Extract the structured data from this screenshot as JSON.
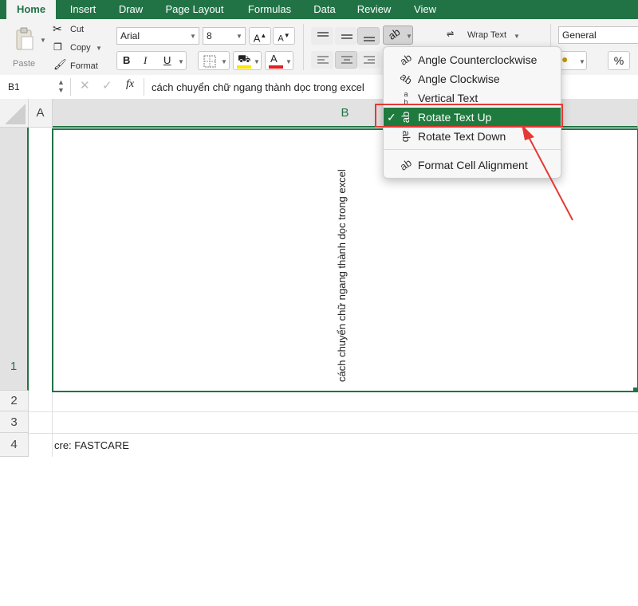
{
  "tabs": [
    "Home",
    "Insert",
    "Draw",
    "Page Layout",
    "Formulas",
    "Data",
    "Review",
    "View"
  ],
  "clipboard": {
    "paste": "Paste",
    "cut": "Cut",
    "copy": "Copy",
    "format": "Format"
  },
  "font": {
    "name": "Arial",
    "size": "8",
    "bold": "B",
    "italic": "I",
    "underline": "U"
  },
  "wrap_text": "Wrap Text",
  "number_format": "General",
  "percent": "%",
  "name_box": "B1",
  "fx": "fx",
  "formula_value": "cách chuyển chữ ngang thành dọc trong excel",
  "columns": [
    "A",
    "B"
  ],
  "rows": [
    "1",
    "2",
    "3",
    "4"
  ],
  "cell_b1": "cách chuyển chữ ngang thành dọc trong excel",
  "cell_a4": "cre: FASTCARE",
  "menu": {
    "items": [
      {
        "label": "Angle Counterclockwise",
        "icon": "angle-ccw-icon"
      },
      {
        "label": "Angle Clockwise",
        "icon": "angle-cw-icon"
      },
      {
        "label": "Vertical Text",
        "icon": "vertical-text-icon"
      },
      {
        "label": "Rotate Text Up",
        "icon": "rotate-up-icon",
        "checked": true
      },
      {
        "label": "Rotate Text Down",
        "icon": "rotate-down-icon"
      },
      {
        "label": "Format Cell Alignment",
        "icon": "format-alignment-icon"
      }
    ],
    "check": "✓"
  },
  "colors": {
    "accent": "#217346",
    "highlight_box": "#e53935",
    "selected": "#1e7a3d"
  }
}
